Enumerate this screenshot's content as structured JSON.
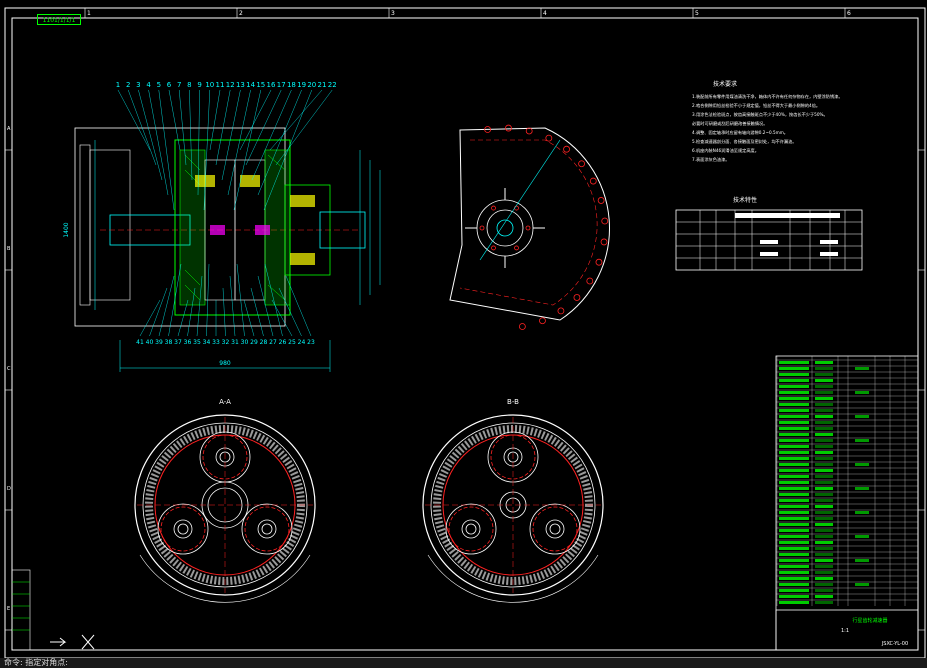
{
  "title_tab": "1101/1/1/1",
  "top_ruler": [
    "1",
    "2",
    "3",
    "4",
    "5",
    "6"
  ],
  "side_ruler": [
    "A",
    "B",
    "C",
    "D",
    "E"
  ],
  "part_numbers_top": [
    "1",
    "2",
    "3",
    "4",
    "5",
    "6",
    "7",
    "8",
    "9",
    "10",
    "11",
    "12",
    "13",
    "14",
    "15",
    "16",
    "17",
    "18",
    "19",
    "20",
    "21",
    "22"
  ],
  "part_numbers_bottom": [
    "41",
    "40",
    "39",
    "38",
    "37",
    "36",
    "35",
    "34",
    "33",
    "32",
    "31",
    "30",
    "29",
    "28",
    "27",
    "26",
    "25",
    "24",
    "23"
  ],
  "dimension_labels": {
    "overall_width": "980",
    "total_height": "1400"
  },
  "section_labels": {
    "left": "A-A",
    "right": "B-B"
  },
  "notes_title": "技术要求",
  "notes_lines": [
    "1.装配前所有零件用煤油清洗干净，箱体内不许有任何杂物存在，内壁涂防锈漆。",
    "2.啮合侧隙用铅丝检验不小于规定值，铅丝不得大于最小侧隙的4倍。",
    "3.用涂色法检验斑点，按齿高接触斑点不少于40%，按齿长不少于50%。",
    "  必要时可研磨或刮后研磨改善接触情况。",
    "4.调整、固定轴承时应留有轴向游隙0.2~0.5mm。",
    "5.检查减速器剖分面、各接触面及密封处，均不许漏油。",
    "6.机座内装N46润滑油至规定高度。",
    "7.表面涂灰色油漆。"
  ],
  "spec_table_title": "技术特性",
  "bom_footer": {
    "label": "行星齿轮减速器",
    "scale": "1:1",
    "code": "JSXC-YL-00"
  },
  "cmdline_text": "命令: 指定对角点:",
  "colors": {
    "green": "#00ff00",
    "cyan": "#00ffff",
    "red": "#ff2020",
    "white": "#ffffff",
    "yellow": "#ffff00",
    "magenta": "#ff00ff"
  }
}
